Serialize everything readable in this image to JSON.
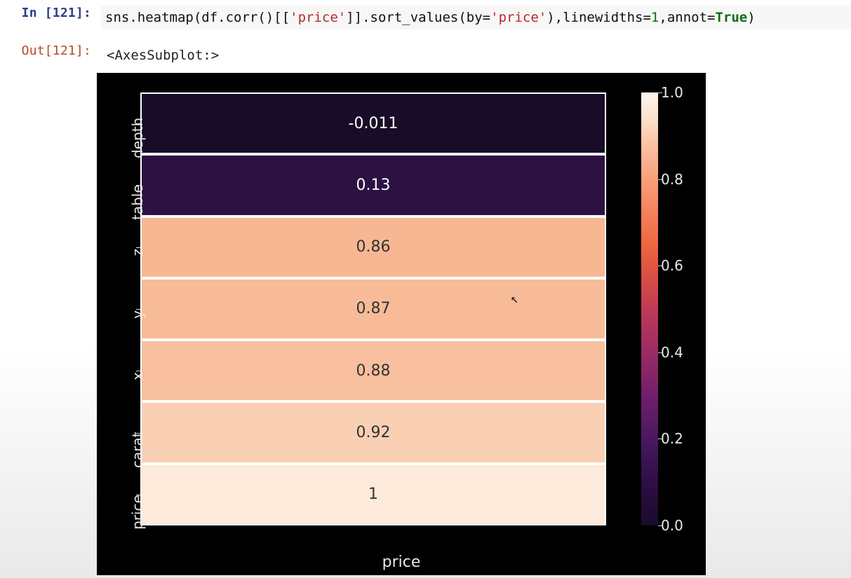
{
  "cell": {
    "in_prompt": "In [121]:",
    "out_prompt": "Out[121]:",
    "code_tokens": [
      {
        "t": "sns",
        "c": "tok-call"
      },
      {
        "t": ".",
        "c": "tok-call"
      },
      {
        "t": "heatmap",
        "c": "tok-call"
      },
      {
        "t": "(df.corr()[[",
        "c": "tok-call"
      },
      {
        "t": "'price'",
        "c": "tok-str"
      },
      {
        "t": "]].sort_values(by=",
        "c": "tok-call"
      },
      {
        "t": "'price'",
        "c": "tok-str"
      },
      {
        "t": "),linewidths=",
        "c": "tok-call"
      },
      {
        "t": "1",
        "c": "tok-num"
      },
      {
        "t": ",annot=",
        "c": "tok-call"
      },
      {
        "t": "True",
        "c": "tok-kw"
      },
      {
        "t": ")",
        "c": "tok-call"
      }
    ],
    "output_repr": "<AxesSubplot:>"
  },
  "chart_data": {
    "type": "heatmap",
    "title": "",
    "xlabel": "price",
    "ylabel": "",
    "x_categories": [
      "price"
    ],
    "y_categories": [
      "depth",
      "table",
      "z",
      "y",
      "x",
      "carat",
      "price"
    ],
    "values": [
      [
        -0.011
      ],
      [
        0.13
      ],
      [
        0.86
      ],
      [
        0.87
      ],
      [
        0.88
      ],
      [
        0.92
      ],
      [
        1
      ]
    ],
    "cell_colors": [
      "#190c28",
      "#2c1142",
      "#f7b793",
      "#f8bb98",
      "#f8c09f",
      "#fad0b5",
      "#fdeada"
    ],
    "annot_colors": [
      "#fefefe",
      "#fefefe",
      "#333333",
      "#333333",
      "#333333",
      "#333333",
      "#333333"
    ],
    "colorbar": {
      "vmin": 0.0,
      "vmax": 1.0,
      "ticks": [
        0.0,
        0.2,
        0.4,
        0.6,
        0.8,
        1.0
      ],
      "tick_labels": [
        "0.0",
        "0.2",
        "0.4",
        "0.6",
        "0.8",
        "1.0"
      ]
    }
  }
}
